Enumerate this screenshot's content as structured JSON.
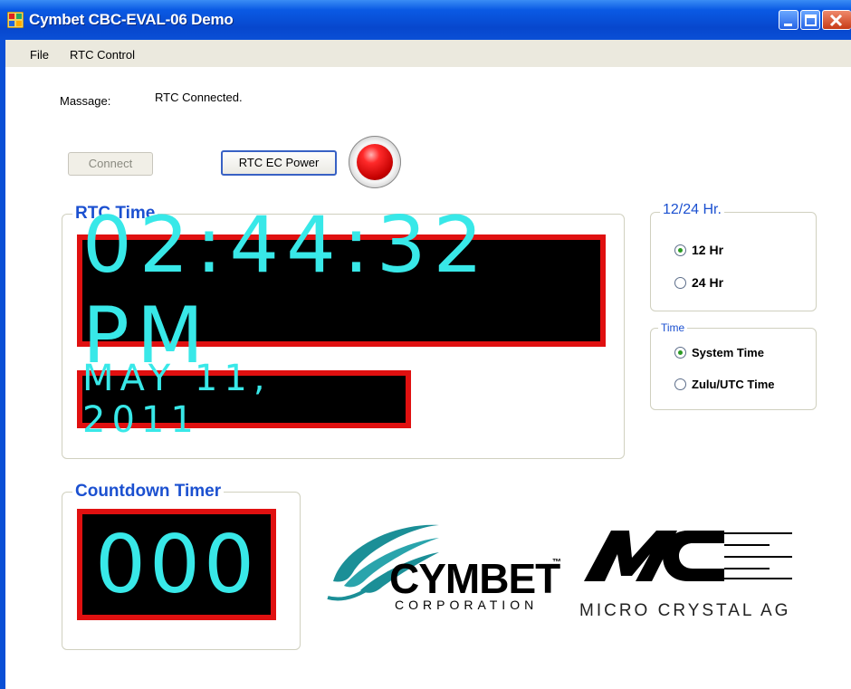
{
  "window": {
    "title": "Cymbet CBC-EVAL-06 Demo"
  },
  "menu": {
    "items": [
      "File",
      "RTC Control"
    ]
  },
  "message": {
    "label": "Massage:",
    "value": "RTC Connected."
  },
  "buttons": {
    "connect": "Connect",
    "rtc_power": "RTC EC Power"
  },
  "rtc_group": {
    "title": "RTC Time",
    "time": "02:44:32 PM",
    "date": "MAY 11, 2011"
  },
  "hour_group": {
    "title": "12/24 Hr.",
    "options": [
      "12 Hr",
      "24 Hr"
    ],
    "selected": "12 Hr"
  },
  "time_group": {
    "title": "Time",
    "options": [
      "System Time",
      "Zulu/UTC Time"
    ],
    "selected": "System Time"
  },
  "countdown_group": {
    "title": "Countdown Timer",
    "value": "000"
  },
  "logos": {
    "cymbet": {
      "name": "CYMBET",
      "tm": "™",
      "sub": "CORPORATION"
    },
    "microcrystal": {
      "mark": "MC",
      "name": "MICRO CRYSTAL AG"
    }
  },
  "colors": {
    "lcd_text": "#38e8e8",
    "lcd_border": "#e01010",
    "group_title": "#1b50d0",
    "led": "#ff2a2a",
    "cymbet_teal": "#1b8f97"
  }
}
